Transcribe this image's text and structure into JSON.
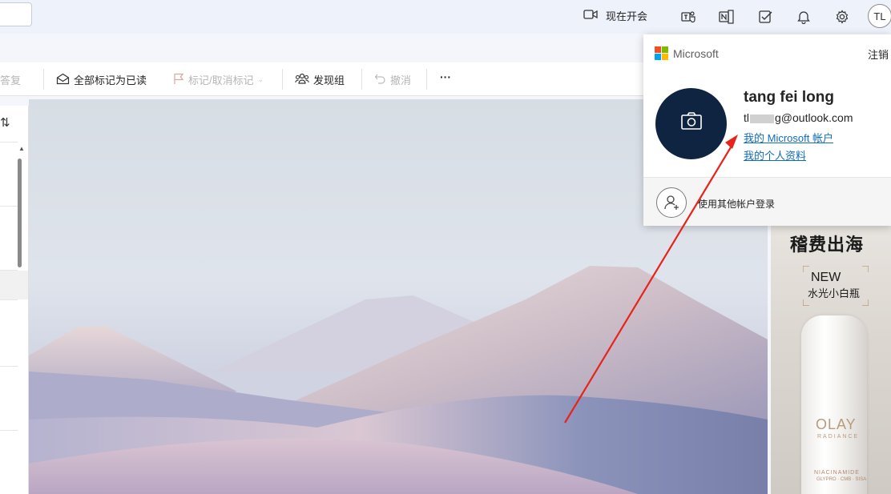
{
  "topbar": {
    "meet_now_label": "现在开会",
    "avatar_initials": "TL"
  },
  "ribbon": {
    "reply_label": "答复",
    "mark_all_read_label": "全部标记为已读",
    "flag_label": "标记/取消标记",
    "discover_groups_label": "发现组",
    "undo_label": "撤消",
    "more_label": "···"
  },
  "account_popup": {
    "brand": "Microsoft",
    "sign_out_label": "注销",
    "user_name": "tang fei long",
    "email_prefix": "tl",
    "email_suffix": "g@outlook.com",
    "my_account_link": "我的 Microsoft 帐户",
    "my_profile_link": "我的个人资料",
    "other_account_label": "使用其他帐户登录"
  },
  "ad": {
    "headline": "稽费出海",
    "new_label": "NEW",
    "product_name": "水光小白瓶",
    "brand": "OLAY",
    "brand_sub": "RADIANCE",
    "ingredient": "NIACINAMIDE",
    "ingredient_sub": "GLYPRO · CMB · SISA"
  },
  "colors": {
    "accent": "#0f6cbd",
    "avatar_bg": "#0f2440",
    "annotation_arrow": "#e8231b",
    "ms_red": "#f25022",
    "ms_green": "#7fba00",
    "ms_blue": "#00a4ef",
    "ms_yellow": "#ffb900"
  }
}
